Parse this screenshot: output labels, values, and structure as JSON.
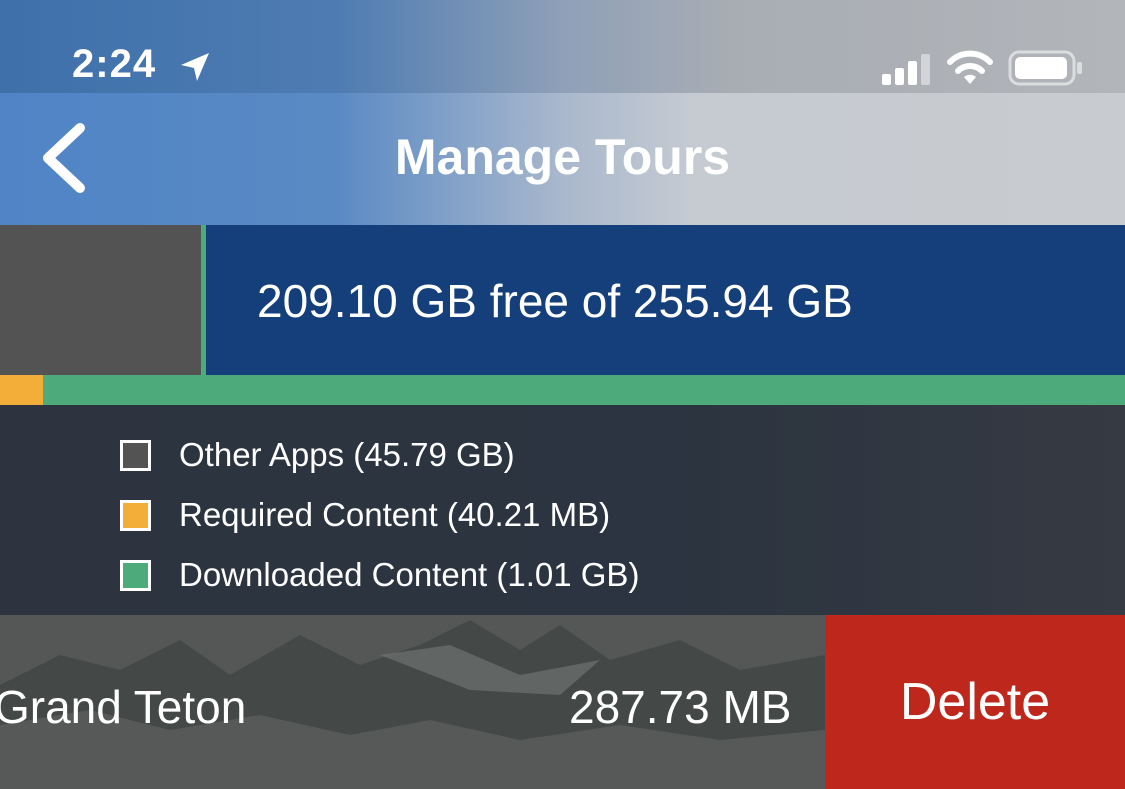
{
  "status_bar": {
    "time": "2:24",
    "location_icon": "location-arrow-icon",
    "signal_icon": "cellular-signal-icon",
    "wifi_icon": "wifi-icon",
    "battery_icon": "battery-icon"
  },
  "nav": {
    "back_icon": "chevron-left-icon",
    "title": "Manage Tours"
  },
  "storage": {
    "summary": "209.10 GB free of 255.94 GB",
    "free_gb": 209.1,
    "total_gb": 255.94
  },
  "legend": {
    "items": [
      {
        "label": "Other Apps (45.79 GB)",
        "color": "#535353"
      },
      {
        "label": "Required Content (40.21 MB)",
        "color": "#f3ae3a"
      },
      {
        "label": "Downloaded Content (1.01 GB)",
        "color": "#4caa7b"
      }
    ]
  },
  "tours": [
    {
      "name": "Grand Teton",
      "size": "287.73 MB",
      "action": "Delete"
    }
  ],
  "colors": {
    "free_space": "#143f7a",
    "used_space": "#535353",
    "required": "#f3ae3a",
    "downloaded": "#4caa7b",
    "delete": "#be271b"
  }
}
